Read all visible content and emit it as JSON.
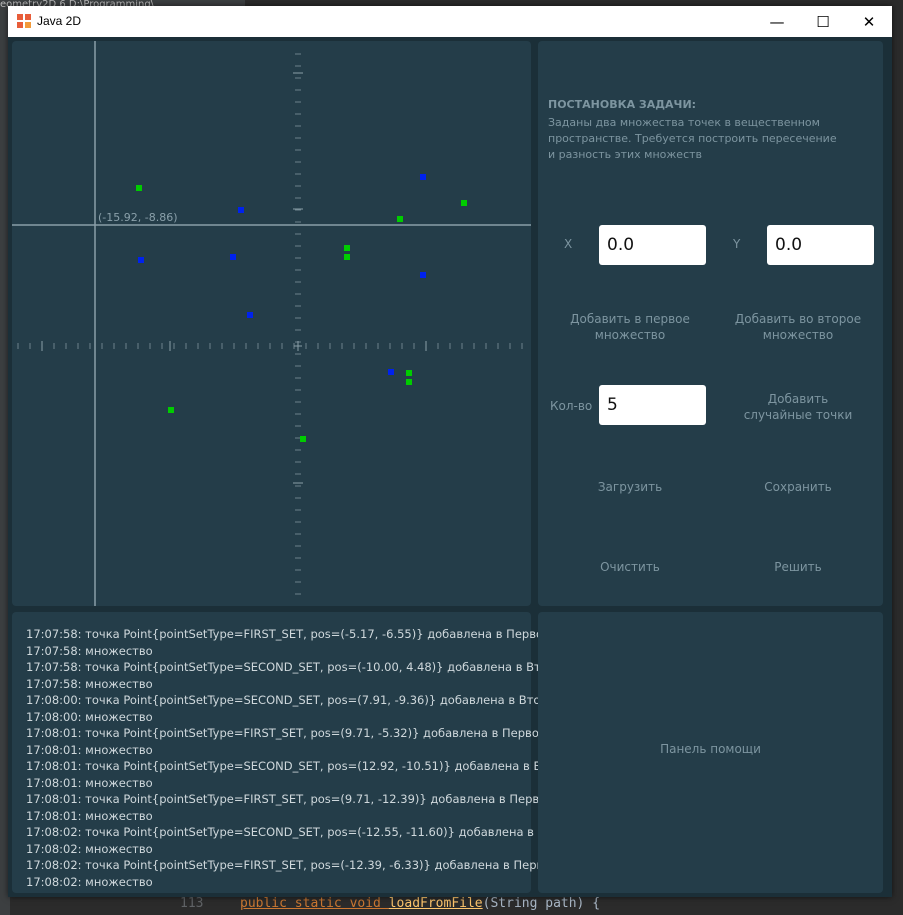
{
  "window": {
    "title": "Java 2D",
    "minimize_symbol": "—",
    "maximize_symbol": "☐",
    "close_symbol": "✕"
  },
  "background_ide": {
    "top_text": "eometry2D  6  D:\\Programming\\",
    "bottom_line_number": "113",
    "bottom_code": {
      "keywords": "public static void ",
      "method": "loadFromFile",
      "rest": "(String path) {"
    }
  },
  "plot": {
    "coord_label": "(-15.92, -8.86)",
    "colors": {
      "first_set": "#00cc00",
      "second_set": "#0022ee",
      "axis": "#8a9ea8",
      "cursor": "#8a9ea8"
    }
  },
  "task": {
    "title": "ПОСТАНОВКА ЗАДАЧИ:",
    "lines": [
      "Заданы два множества точек в вещественном",
      "пространстве. Требуется построить пересечение",
      "и разность этих множеств"
    ]
  },
  "inputs": {
    "x_label": "X",
    "x_value": "0.0",
    "y_label": "Y",
    "y_value": "0.0",
    "count_label": "Кол-во",
    "count_value": "5"
  },
  "buttons": {
    "add_first": [
      "Добавить в первое",
      "множество"
    ],
    "add_second": [
      "Добавить во второе",
      "множество"
    ],
    "add_random": [
      "Добавить",
      "случайные точки"
    ],
    "load": "Загрузить",
    "save": "Сохранить",
    "clear": "Очистить",
    "solve": "Решить"
  },
  "log": [
    "17:07:58: точка Point{pointSetType=FIRST_SET, pos=(-5.17, -6.55)} добавлена в Первое",
    "17:07:58: множество",
    "17:07:58: точка Point{pointSetType=SECOND_SET, pos=(-10.00, 4.48)} добавлена в Второе",
    "17:07:58: множество",
    "17:08:00: точка Point{pointSetType=SECOND_SET, pos=(7.91, -9.36)} добавлена в Второе",
    "17:08:00: множество",
    "17:08:01: точка Point{pointSetType=FIRST_SET, pos=(9.71, -5.32)} добавлена в Первое",
    "17:08:01: множество",
    "17:08:01: точка Point{pointSetType=SECOND_SET, pos=(12.92, -10.51)} добавлена в Второе",
    "17:08:01: множество",
    "17:08:01: точка Point{pointSetType=FIRST_SET, pos=(9.71, -12.39)} добавлена в Первое",
    "17:08:01: множество",
    "17:08:02: точка Point{pointSetType=SECOND_SET, pos=(-12.55, -11.60)} добавлена в Второе",
    "17:08:02: множество",
    "17:08:02: точка Point{pointSetType=FIRST_SET, pos=(-12.39, -6.33)} добавлена в Первое",
    "17:08:02: множество"
  ],
  "help": {
    "label": "Панель помощи"
  }
}
